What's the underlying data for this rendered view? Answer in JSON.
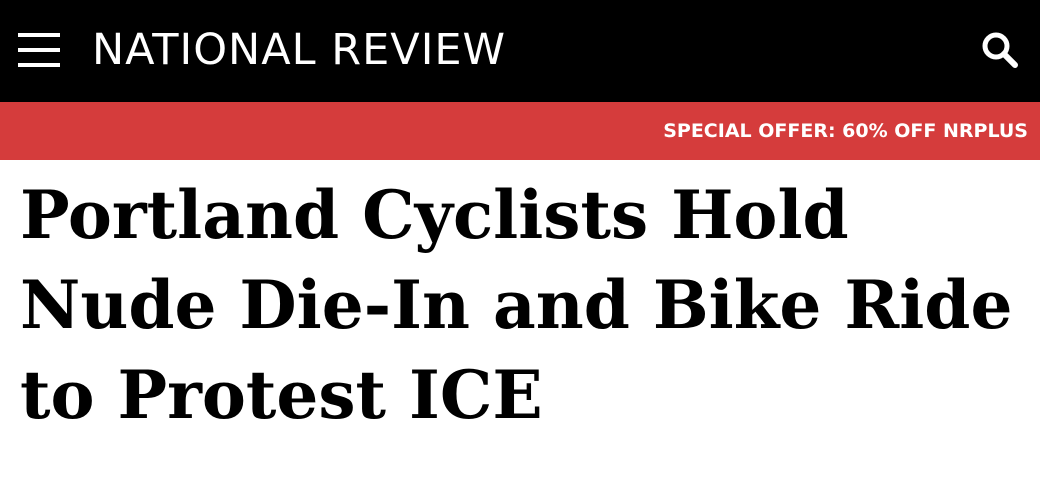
{
  "header": {
    "logo_text": "NATIONAL REVIEW",
    "menu_icon": "hamburger-menu-icon",
    "search_icon": "search-icon",
    "background_color": "#000000"
  },
  "promo": {
    "label": "SPECIAL OFFER: 60% OFF NRPLUS",
    "background_color": "#d53c3c"
  },
  "article": {
    "headline": "Portland Cyclists Hold Nude Die-In and Bike Ride to Protest ICE"
  }
}
